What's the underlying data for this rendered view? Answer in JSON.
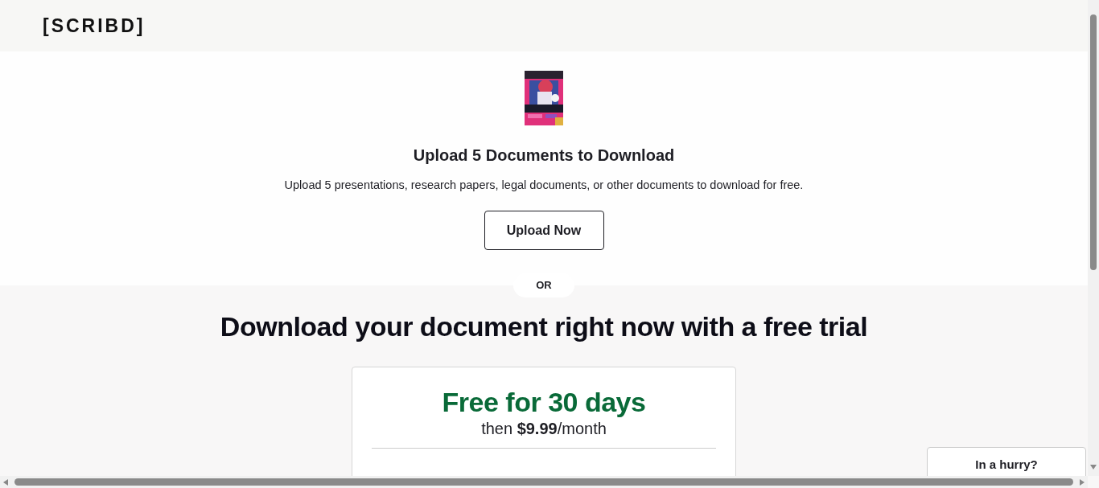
{
  "header": {
    "logo": "[SCRIBD]"
  },
  "upload": {
    "title": "Upload 5 Documents to Download",
    "description": "Upload 5 presentations, research papers, legal documents, or other documents to download for free.",
    "button": "Upload Now"
  },
  "divider": "OR",
  "trial": {
    "heading": "Download your document right now with a free trial",
    "offer": "Free for 30 days",
    "price": "then **$9.99**/month"
  },
  "hurry_card": {
    "text": "In a hurry?"
  }
}
